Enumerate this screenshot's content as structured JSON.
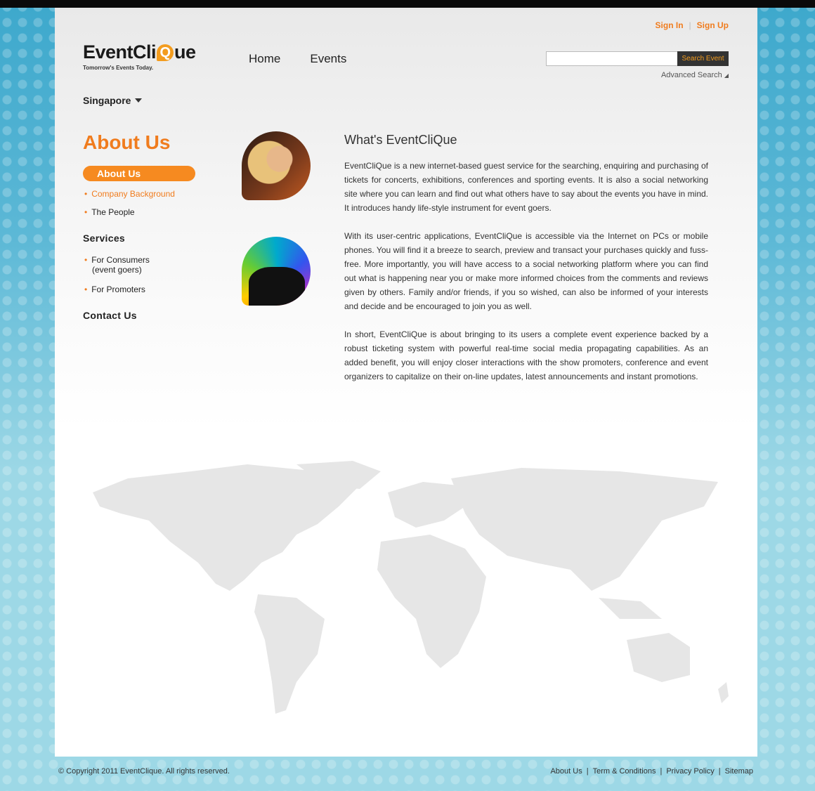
{
  "header": {
    "sign_in": "Sign In",
    "sign_up": "Sign Up",
    "logo_main": "EventCli",
    "logo_q": "Q",
    "logo_end": "ue",
    "logo_tagline": "Tomorrow's Events Today.",
    "nav": [
      "Home",
      "Events"
    ],
    "search_button": "Search Event",
    "search_placeholder": "",
    "advanced_search": "Advanced Search",
    "location": "Singapore"
  },
  "sidebar": {
    "title": "About Us",
    "active_item": "About Us",
    "about_links": [
      "Company Background",
      "The People"
    ],
    "services_heading": "Services",
    "services_links": [
      "For Consumers",
      "(event goers)",
      "For Promoters"
    ],
    "contact_heading": "Contact Us"
  },
  "content": {
    "heading": "What's EventCliQue",
    "paragraphs": [
      "EventCliQue is a new internet-based guest service for the searching, enquiring and purchasing of tickets for concerts, exhibitions, conferences and sporting events. It is also a social networking site where you can learn and find out what others have to say about the events you have in mind. It introduces handy life-style instrument for event goers.",
      "With its user-centric applications, EventCliQue is accessible via the Internet on PCs or mobile phones. You will find it a breeze to search, preview and transact your purchases quickly and fuss-free. More importantly, you will have access to a social networking platform where you can find out what is happening near you or make more informed choices from the comments and reviews given by others. Family and/or friends, if you so wished, can also be informed of your interests and decide and be encouraged to join you as well.",
      "In short, EventCliQue is about bringing to its users a complete event experience backed by a robust ticketing system with powerful real-time social media propagating capabilities. As an added benefit, you will enjoy closer interactions with the show promoters, conference and event organizers to capitalize on their on-line updates, latest announcements and instant promotions."
    ]
  },
  "footer": {
    "copyright": "© Copyright 2011 EventClique. All rights reserved.",
    "links": [
      "About Us",
      "Term & Conditions",
      "Privacy Policy",
      "Sitemap"
    ]
  },
  "colors": {
    "accent": "#f07c1e",
    "background": "#5cb8d6",
    "search_button_bg": "#333333"
  }
}
